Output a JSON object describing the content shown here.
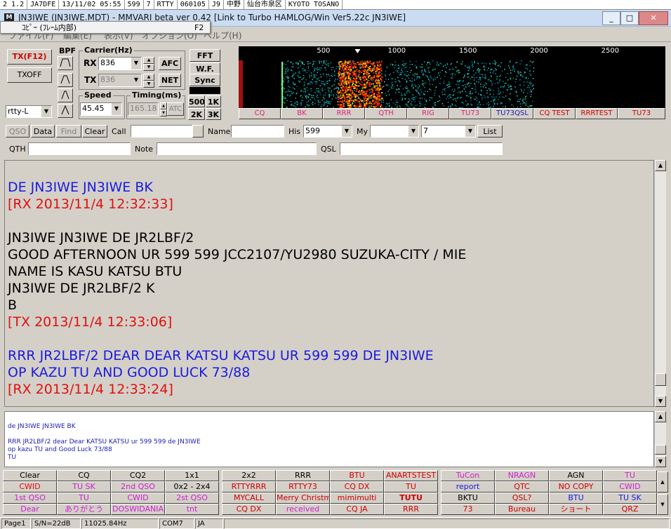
{
  "bg_strip": [
    "2 1.2",
    "JA7DFE",
    "13/11/02 05:55",
    "599",
    "7",
    "RTTY",
    "060105",
    "J9",
    "中野",
    "仙台市泉区",
    "KYOTO TOSANO"
  ],
  "window": {
    "title": "JN3IWE (JN3IWE.MDT) - MMVARI beta ver 0.42 [Link to Turbo HAMLOG/Win Ver5.22c JN3IWE]",
    "icon": "MMVARI-app-icon",
    "minimize": "0",
    "maximize": "1",
    "close": "r",
    "context_label": "ｺﾋﾟｰ (ﾌﾚｰﾑ内部)",
    "context_key": "F2"
  },
  "menu": [
    "ファイル(F)",
    "編集(E)",
    "表示(V)",
    "オプション(O)",
    "ヘルプ(H)"
  ],
  "controls": {
    "tx_button": "TX(F12)",
    "txoff_button": "TXOFF",
    "mode_select": "rtty-L",
    "bpf_label": "BPF",
    "carrier_label": "Carrier(Hz)",
    "rx_label": "RX",
    "rx_value": "836",
    "tx_label": "TX",
    "tx_value": "836",
    "afc": "AFC",
    "net": "NET",
    "speed_label": "Speed",
    "speed_value": "45.45",
    "timing_label": "Timing(ms)",
    "timing_value": "165.18",
    "atc": "ATC",
    "fft": "FFT",
    "wf": "W.F.",
    "sync": "Sync",
    "b500": "500",
    "b1k": "1K",
    "b2k": "2K",
    "b3k": "3K"
  },
  "waterfall": {
    "ticks": [
      "500",
      "1000",
      "1500",
      "2000",
      "2500"
    ],
    "marker_colors": {
      "signal": "#ff2a00",
      "noise": "#00c8a0",
      "carrier": "#7dff7d"
    }
  },
  "wf_macros": [
    {
      "label": "CQ",
      "color": "#e0207a"
    },
    {
      "label": "BK",
      "color": "#e0207a"
    },
    {
      "label": "RRR",
      "color": "#e0207a"
    },
    {
      "label": "QTH",
      "color": "#e0207a"
    },
    {
      "label": "RIG",
      "color": "#e0207a"
    },
    {
      "label": "TU73",
      "color": "#e0207a"
    },
    {
      "label": "TU73QSL",
      "color": "#1a1ab0"
    },
    {
      "label": "CQ TEST",
      "color": "#d00000"
    },
    {
      "label": "RRRTEST",
      "color": "#d00000"
    },
    {
      "label": "TU73",
      "color": "#d00000"
    }
  ],
  "logbar": {
    "qso": "QSO",
    "data": "Data",
    "find": "Find",
    "clear": "Clear",
    "call_label": "Call",
    "call_value": "",
    "name_label": "Name",
    "name_value": "",
    "his_label": "His",
    "his_value": "599",
    "my_label": "My",
    "my_value": "",
    "band_value": "7",
    "list": "List",
    "qth_label": "QTH",
    "note_label": "Note",
    "qsl_label": "QSL"
  },
  "rx_lines": [
    {
      "text": "DE JN3IWE JN3IWE BK",
      "color": "#1a1ae0"
    },
    {
      "text": "[RX 2013/11/4 12:32:33]",
      "color": "#e01010"
    },
    {
      "text": "",
      "color": "#000"
    },
    {
      "text": "JN3IWE JN3IWE DE JR2LBF/2",
      "color": "#000"
    },
    {
      "text": "GOOD AFTERNOON UR 599 599 JCC2107/YU2980 SUZUKA-CITY / MIE",
      "color": "#000"
    },
    {
      "text": "NAME IS KASU KATSU BTU",
      "color": "#000"
    },
    {
      "text": "JN3IWE DE JR2LBF/2 K",
      "color": "#000"
    },
    {
      "text": "B",
      "color": "#000"
    },
    {
      "text": "[TX 2013/11/4 12:33:06]",
      "color": "#e01010"
    },
    {
      "text": "",
      "color": "#000"
    },
    {
      "text": "RRR JR2LBF/2 DEAR DEAR KATSU KATSU UR 599 599 DE JN3IWE",
      "color": "#1a1ae0"
    },
    {
      "text": "OP KAZU TU AND GOOD LUCK 73/88",
      "color": "#1a1ae0"
    },
    {
      "text": "[RX 2013/11/4 12:33:24]",
      "color": "#e01010"
    }
  ],
  "tx_lines": [
    "de JN3IWE JN3IWE BK",
    "",
    "RRR JR2LBF/2 dear Dear KATSU KATSU ur 599 599 de JN3IWE",
    "op kazu TU and Good Luck 73/88",
    "TU"
  ],
  "macros": [
    [
      {
        "t": "Clear",
        "c": "#000"
      },
      {
        "t": "CQ",
        "c": "#000"
      },
      {
        "t": "CQ2",
        "c": "#000"
      },
      {
        "t": "1x1",
        "c": "#000"
      },
      {
        "t": "2x2",
        "c": "#000"
      },
      {
        "t": "RRR",
        "c": "#000"
      },
      {
        "t": "BTU",
        "c": "#d00000"
      },
      {
        "t": "ANARTSTEST",
        "c": "#d00000"
      },
      {
        "t": "TuCon",
        "c": "#d020d0"
      },
      {
        "t": "NRAGN",
        "c": "#d020d0"
      },
      {
        "t": "AGN",
        "c": "#000"
      },
      {
        "t": "TU",
        "c": "#d020d0"
      }
    ],
    [
      {
        "t": "CWID",
        "c": "#e01010"
      },
      {
        "t": "TU SK",
        "c": "#d020d0"
      },
      {
        "t": "2nd QSO",
        "c": "#d020d0"
      },
      {
        "t": "0x2 - 2x4",
        "c": "#000"
      },
      {
        "t": "RTTYRRR",
        "c": "#d00000"
      },
      {
        "t": "RTTY73",
        "c": "#d00000"
      },
      {
        "t": "CQ DX",
        "c": "#d00000"
      },
      {
        "t": "TU",
        "c": "#d00000"
      },
      {
        "t": "report",
        "c": "#1a1ae0"
      },
      {
        "t": "QTC",
        "c": "#d00000"
      },
      {
        "t": "NO COPY",
        "c": "#d00000"
      },
      {
        "t": "CWID",
        "c": "#d020d0"
      }
    ],
    [
      {
        "t": "1st QSO",
        "c": "#d020d0"
      },
      {
        "t": "TU",
        "c": "#d020d0"
      },
      {
        "t": "CWID",
        "c": "#d020d0"
      },
      {
        "t": "2st QSO",
        "c": "#d020d0"
      },
      {
        "t": "MYCALL",
        "c": "#d00000"
      },
      {
        "t": "Merry Christma",
        "c": "#d00000"
      },
      {
        "t": "mimimulti",
        "c": "#d00000"
      },
      {
        "t": "TUTU",
        "c": "#d00000"
      },
      {
        "t": "BKTU",
        "c": "#000"
      },
      {
        "t": "QSL?",
        "c": "#d00000"
      },
      {
        "t": "BTU",
        "c": "#1a1ae0"
      },
      {
        "t": "TU SK",
        "c": "#1a1ae0"
      }
    ],
    [
      {
        "t": "Dear",
        "c": "#d020d0"
      },
      {
        "t": "ありがとう",
        "c": "#d020d0"
      },
      {
        "t": "DOSWIDANIA",
        "c": "#d020d0"
      },
      {
        "t": "tnt",
        "c": "#d020d0"
      },
      {
        "t": "CQ DX",
        "c": "#d00000"
      },
      {
        "t": "received",
        "c": "#d020d0"
      },
      {
        "t": "CQ JA",
        "c": "#d00000"
      },
      {
        "t": "RRR",
        "c": "#d00000"
      },
      {
        "t": "73",
        "c": "#d00000"
      },
      {
        "t": "Bureau",
        "c": "#d00000"
      },
      {
        "t": "ショート",
        "c": "#d00000"
      },
      {
        "t": "QRZ",
        "c": "#d00000"
      }
    ]
  ],
  "status": {
    "page": "Page1",
    "sn": "S/N=22dB",
    "freq": "11025.84Hz",
    "com": "COM7",
    "lang": "JA"
  }
}
